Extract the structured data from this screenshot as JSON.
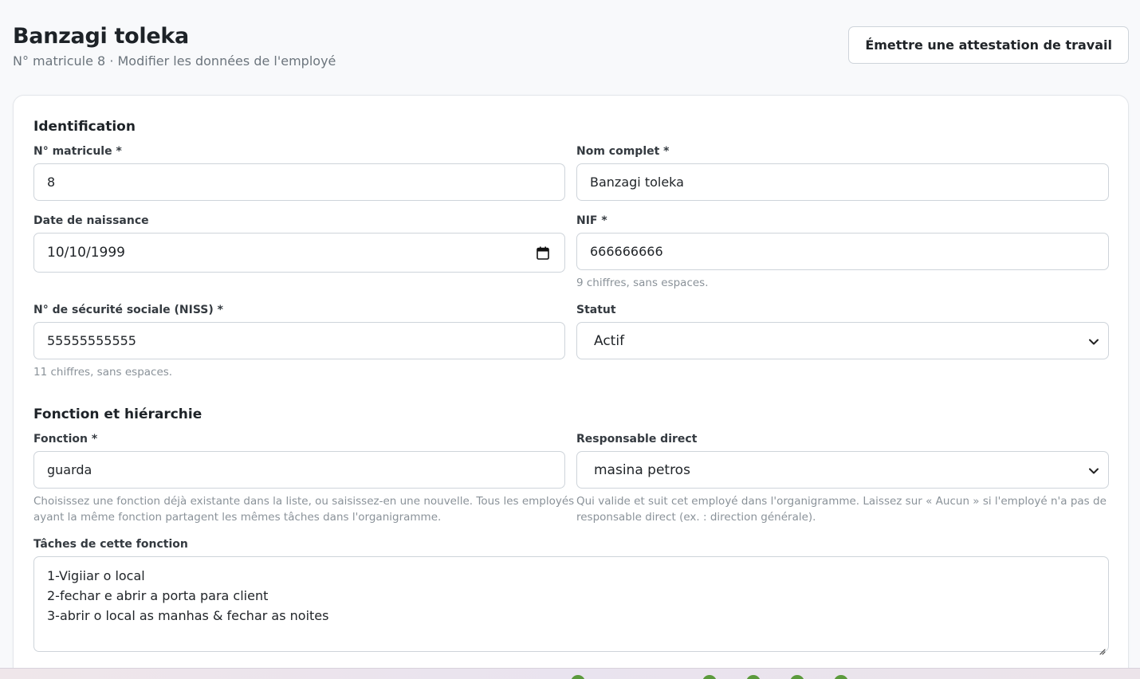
{
  "header": {
    "title": "Banzagi toleka",
    "subtitle": "N° matricule 8 · Modifier les données de l'employé",
    "action_label": "Émettre une attestation de travail"
  },
  "identification": {
    "section_title": "Identification",
    "matricule": {
      "label": "N° matricule *",
      "value": "8"
    },
    "nom": {
      "label": "Nom complet *",
      "value": "Banzagi toleka"
    },
    "naissance": {
      "label": "Date de naissance",
      "value": "10/10/1999",
      "icon": "calendar-icon"
    },
    "nif": {
      "label": "NIF *",
      "value": "666666666",
      "hint": "9 chiffres, sans espaces."
    },
    "niss": {
      "label": "N° de sécurité sociale (NISS) *",
      "value": "55555555555",
      "hint": "11 chiffres, sans espaces."
    },
    "statut": {
      "label": "Statut",
      "value": "Actif",
      "icon": "chevron-down-icon"
    }
  },
  "fonction_section": {
    "section_title": "Fonction et hiérarchie",
    "fonction": {
      "label": "Fonction *",
      "value": "guarda",
      "hint_line1": "Choisissez une fonction déjà existante dans la liste, ou saisissez-en une nouvelle. Tous les employés",
      "hint_line2": "ayant la même fonction partagent les mêmes tâches dans l'organigramme."
    },
    "responsable": {
      "label": "Responsable direct",
      "value": "masina petros",
      "icon": "chevron-down-icon",
      "hint_line1": "Qui valide et suit cet employé dans l'organigramme. Laissez sur « Aucun » si l'employé n'a pas de",
      "hint_line2": "responsable direct (ex. : direction générale)."
    },
    "taches": {
      "label": "Tâches de cette fonction",
      "lines": [
        "1-Vigiiar o local",
        "2-fechar e abrir a porta para client",
        "3-abrir o local as manhas & fechar as noites"
      ]
    }
  },
  "colors": {
    "border": "#ced4da",
    "hint": "#8a9299",
    "background": "#f8f9fb"
  }
}
